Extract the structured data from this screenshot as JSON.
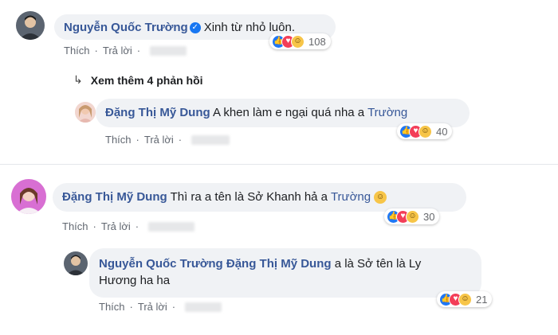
{
  "thread1": {
    "comment": {
      "author": "Nguyễn Quốc Trường",
      "text": "Xinh từ nhỏ luôn.",
      "reaction_count": "108",
      "actions": {
        "like": "Thích",
        "reply": "Trả lời"
      }
    },
    "view_more": "Xem thêm 4 phản hồi",
    "reply": {
      "author": "Đặng Thị Mỹ Dung",
      "text": "A khen làm e ngại quá nha a",
      "mention": "Trường",
      "reaction_count": "40",
      "actions": {
        "like": "Thích",
        "reply": "Trả lời"
      }
    }
  },
  "thread2": {
    "comment": {
      "author": "Đặng Thị Mỹ Dung",
      "text": "Thì ra a tên là Sở Khanh hả a",
      "mention": "Trường",
      "reaction_count": "30",
      "actions": {
        "like": "Thích",
        "reply": "Trả lời"
      }
    },
    "reply": {
      "author": "Nguyễn Quốc Trường",
      "mention": "Đặng Thị Mỹ Dung",
      "text_line1": "a là Sở tên là Ly",
      "text_line2": "Hương ha ha",
      "reaction_count": "21",
      "actions": {
        "like": "Thích",
        "reply": "Trả lời"
      }
    }
  },
  "icons": {
    "reactions": [
      "like-icon",
      "love-icon",
      "haha-icon"
    ],
    "verified": "verified-badge-icon",
    "reply_arrow": "reply-arrow-icon"
  },
  "colors": {
    "author": "#385898",
    "bubble": "#f0f2f5",
    "action_text": "#616770",
    "like": "#2078f4",
    "love": "#f33e58",
    "haha": "#f7c548"
  }
}
